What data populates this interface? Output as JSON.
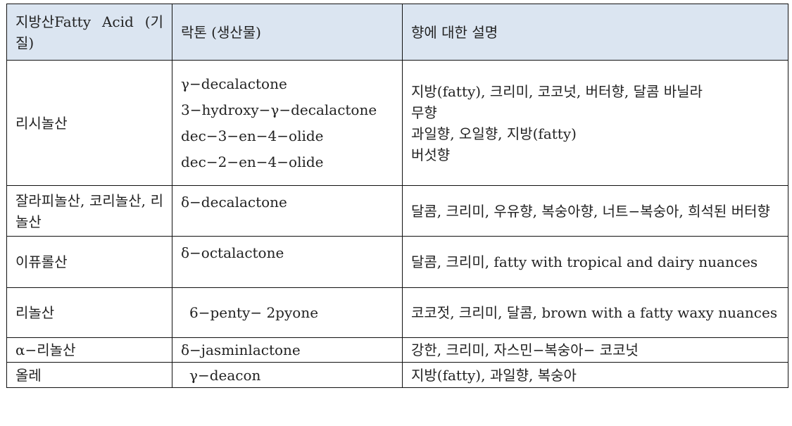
{
  "table": {
    "headers": [
      "지방산Fatty Acid (기질)",
      "락톤 (생산물)",
      "향에 대한 설명"
    ],
    "rows": [
      {
        "fatty_acid": "리시놀산",
        "lactones": [
          "γ−decalactone",
          "3−hydroxy−γ−decalactone",
          "dec−3−en−4−olide",
          "dec−2−en−4−olide"
        ],
        "descriptions": [
          "지방(fatty), 크리미, 코코넛, 버터향, 달콤 바닐라",
          "무향",
          "과일향, 오일향, 지방(fatty)",
          "버섯향"
        ]
      },
      {
        "fatty_acid": "잘라피놀산, 코리놀산, 리놀산",
        "lactones": [
          "δ−decalactone"
        ],
        "descriptions": [
          "달콤, 크리미, 우유향, 복숭아향, 너트−복숭아, 희석된 버터향"
        ]
      },
      {
        "fatty_acid": "이퓨롤산",
        "lactones": [
          "δ−octalactone"
        ],
        "descriptions": [
          "달콤, 크리미, fatty with tropical and dairy nuances"
        ]
      },
      {
        "fatty_acid": "리놀산",
        "lactones": [
          "6−penty− 2pyone"
        ],
        "descriptions": [
          "코코젓, 크리미, 달콤, brown with a fatty waxy nuances"
        ]
      },
      {
        "fatty_acid": "α−리놀산",
        "lactones": [
          "δ−jasminlactone"
        ],
        "descriptions": [
          "강한, 크리미, 자스민−복숭아− 코코넛"
        ]
      },
      {
        "fatty_acid": "올레",
        "lactones": [
          "γ−deacon"
        ],
        "descriptions": [
          "지방(fatty), 과일향, 복숭아"
        ]
      }
    ]
  }
}
